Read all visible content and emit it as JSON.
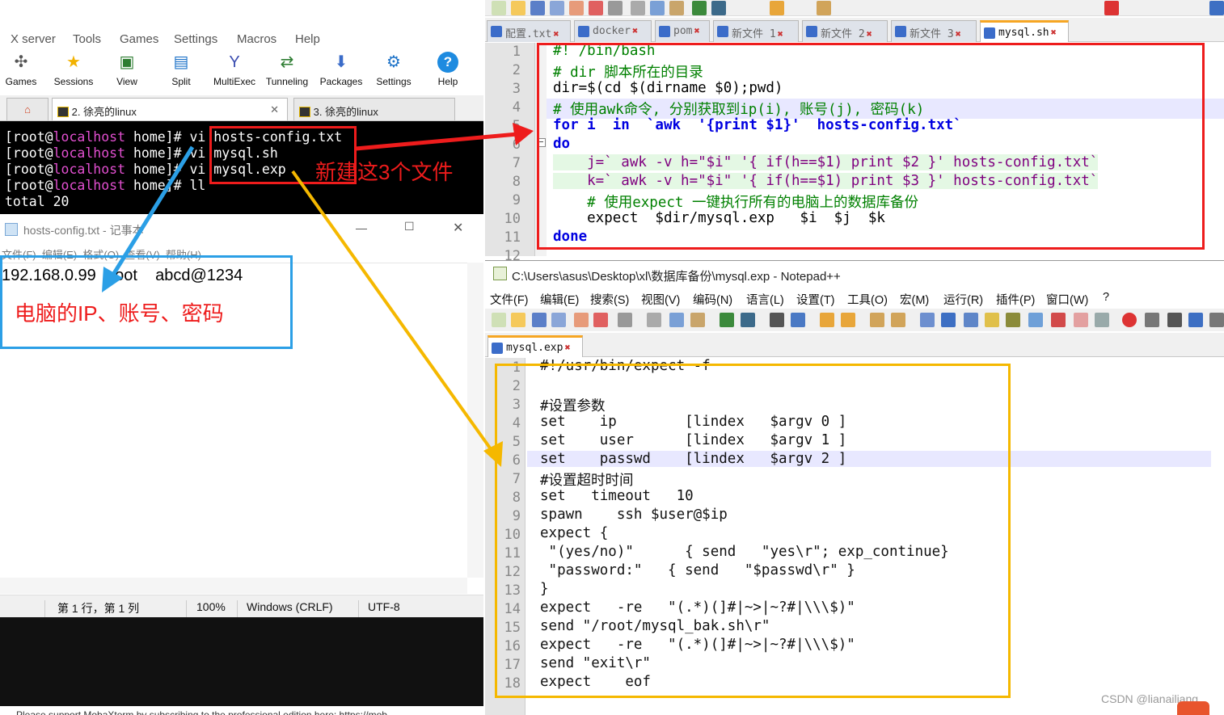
{
  "moba": {
    "menu": [
      "X server",
      "Tools",
      "Games",
      "Settings",
      "Macros",
      "Help"
    ],
    "toolbar": [
      {
        "label": "Games",
        "icon": "gamepad-icon"
      },
      {
        "label": "Sessions",
        "icon": "star-icon"
      },
      {
        "label": "View",
        "icon": "monitor-icon"
      },
      {
        "label": "Split",
        "icon": "split-icon"
      },
      {
        "label": "MultiExec",
        "icon": "fork-icon"
      },
      {
        "label": "Tunneling",
        "icon": "tunnel-icon"
      },
      {
        "label": "Packages",
        "icon": "download-icon"
      },
      {
        "label": "Settings",
        "icon": "gears-icon"
      },
      {
        "label": "Help",
        "icon": "help-icon"
      }
    ],
    "tabs": [
      {
        "label": "2. 徐亮的linux",
        "close": "✕"
      },
      {
        "label": "3. 徐亮的linux"
      }
    ],
    "terminal": [
      {
        "user": "[root@",
        "host": "localhost",
        "rest": " home]# vi hosts-config.txt"
      },
      {
        "user": "[root@",
        "host": "localhost",
        "rest": " home]# vi mysql.sh"
      },
      {
        "user": "[root@",
        "host": "localhost",
        "rest": " home]# vi mysql.exp"
      },
      {
        "user": "[root@",
        "host": "localhost",
        "rest": " home]# ll"
      },
      {
        "user": "total 20",
        "host": "",
        "rest": ""
      }
    ]
  },
  "notepad": {
    "title": "hosts-config.txt - 记事本",
    "menu": "文件(F)  编辑(E)  格式(O)  查看(V)  帮助(H)",
    "content": "192.168.0.99   root    abcd@1234",
    "status": {
      "pos": "第 1 行，第 1 列",
      "zoom": "100%",
      "eol": "Windows (CRLF)",
      "enc": "UTF-8"
    },
    "bottom_text": "Please support MobaXterm by subscribing to the professional edition here: https://mob"
  },
  "npp_top": {
    "tabs": [
      "配置.txt",
      "docker",
      "pom",
      "新文件 1",
      "新文件 2",
      "新文件 3",
      "mysql.sh"
    ],
    "lines": [
      "#! /bin/bash",
      "# dir 脚本所在的目录",
      "dir=$(cd $(dirname $0);pwd)",
      "# 使用awk命令, 分别获取到ip(i), 账号(j), 密码(k)",
      "for i  in  `awk  '{print $1}'  hosts-config.txt`",
      "do",
      "    j=` awk -v h=\"$i\" '{ if(h==$1) print $2 }' hosts-config.txt`",
      "    k=` awk -v h=\"$i\" '{ if(h==$1) print $3 }' hosts-config.txt`",
      "    # 使用expect 一键执行所有的电脑上的数据库备份",
      "    expect  $dir/mysql.exp   $i  $j  $k",
      "done"
    ],
    "line_numbers": [
      "1",
      "2",
      "3",
      "4",
      "5",
      "6",
      "7",
      "8",
      "9",
      "10",
      "11",
      "12"
    ]
  },
  "npp_bottom": {
    "title": "C:\\Users\\asus\\Desktop\\xl\\数据库备份\\mysql.exp - Notepad++",
    "menu": [
      "文件(F)",
      "编辑(E)",
      "搜索(S)",
      "视图(V)",
      "编码(N)",
      "语言(L)",
      "设置(T)",
      "工具(O)",
      "宏(M)",
      "运行(R)",
      "插件(P)",
      "窗口(W)",
      "?"
    ],
    "tab": "mysql.exp",
    "lines": [
      "#!/usr/bin/expect -f",
      "",
      "#设置参数",
      "set    ip        [lindex   $argv 0 ]",
      "set    user      [lindex   $argv 1 ]",
      "set    passwd    [lindex   $argv 2 ]",
      "#设置超时时间",
      "set   timeout   10",
      "spawn    ssh $user@$ip",
      "expect {",
      " \"(yes/no)\"      { send   \"yes\\r\"; exp_continue}",
      " \"password:\"   { send   \"$passwd\\r\" }",
      "}",
      "expect   -re   \"(.*)(]#|~>|~?#|\\\\\\$)\"",
      "send \"/root/mysql_bak.sh\\r\"",
      "expect   -re   \"(.*)(]#|~>|~?#|\\\\\\$)\"",
      "send \"exit\\r\"",
      "expect    eof"
    ],
    "line_numbers": [
      "1",
      "2",
      "3",
      "4",
      "5",
      "6",
      "7",
      "8",
      "9",
      "10",
      "11",
      "12",
      "13",
      "14",
      "15",
      "16",
      "17",
      "18"
    ]
  },
  "annotations": {
    "new_files": "新建这3个文件",
    "pc_info": "电脑的IP、账号、密码"
  },
  "watermark": "CSDN @lianailiang",
  "colors": {
    "red": "#ee1c1c",
    "blue": "#2b9fe6",
    "yellow": "#f5b800"
  }
}
